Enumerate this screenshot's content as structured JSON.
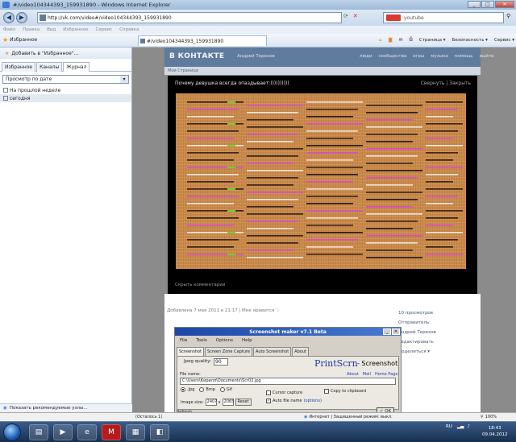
{
  "window": {
    "title": "#/video104344393_159931890 - Windows Internet Explorer",
    "minimize": "_",
    "maximize": "□",
    "close": "✕"
  },
  "addressbar": {
    "url": "http://vk.com/video#/video104344393_159931890",
    "search_value": "youtube"
  },
  "menubar": [
    "Файл",
    "Правка",
    "Вид",
    "Избранное",
    "Сервис",
    "Справка"
  ],
  "commandbar": {
    "favorites": "Избранное",
    "page_tab": "#/video104344393_159931890",
    "right_items": [
      "Страница ▾",
      "Безопасность ▾",
      "Сервис ▾"
    ]
  },
  "favorites_pane": {
    "add_button": "Добавить в \"Избранное\"...",
    "tabs": [
      "Избранное",
      "Каналы",
      "Журнал"
    ],
    "active_tab": 2,
    "view_select": "Просмотр по дате",
    "history": [
      "На прошлой неделе",
      "сегодня"
    ],
    "bottom_link": "Показать рекомендуемые узлы..."
  },
  "vk": {
    "logo": "В КОНТАКТЕ",
    "user": "Андрей Терехов",
    "nav": [
      "люди",
      "сообщества",
      "игры",
      "музыка",
      "помощь",
      "выйти"
    ],
    "subnav": "Мои Страница",
    "video_title": "Почему девушка всегда опаздывает:))))))))))",
    "video_controls": "Свернуть | Закрыть",
    "hide_comments": "Скрыть комментарии",
    "added_line": "Добавлена 7 мая 2011 в 21:17 | Мне нравится ♡",
    "right_col": [
      "10 просмотров",
      "Отправитель:",
      "Андрей Терехов",
      "Редактировать",
      "Поделиться ▾"
    ]
  },
  "dialog": {
    "title": "Screenshot maker v7.1 Beta",
    "menu": [
      "File",
      "Tools",
      "Options",
      "Help"
    ],
    "tabs": [
      "Screenshot",
      "Screen Zone Capture",
      "Auto Screenshot",
      "About"
    ],
    "jpeg_quality_label": "Jpeg quality:",
    "jpeg_quality": "90",
    "brand_a": "PrintScrn",
    "brand_b": "- Screenshot",
    "links": [
      "About",
      "Mail",
      "Home Page"
    ],
    "file_name_label": "File name:",
    "file_name": "C:\\Users\\Кирилл\\Documents\\Scr02.jpg",
    "formats": [
      ".Jpg",
      "Bmp",
      "Gif"
    ],
    "image_size_label": "Image size:",
    "width": "2407",
    "height": "2065",
    "reset": "Reset",
    "cursor_capture": "Cursor capture",
    "auto_file_name": "Auto file name",
    "options_link": "(options)",
    "copy_clipboard": "Copy to clipboard",
    "ok": "OK",
    "refresh": "Refresh"
  },
  "statusbar": {
    "left": "(Осталось 1)",
    "security": "Интернет | Защищенный режим: выкл.",
    "zoom": "100%"
  },
  "taskbar": {
    "lang": "RU",
    "time": "18:43",
    "date": "09.04.2012"
  },
  "colors": {
    "video_bg": "#c98b4c",
    "accent_magenta": "#d84cc8",
    "accent_green": "#6ad431",
    "vk_blue": "#5f7c9e"
  }
}
